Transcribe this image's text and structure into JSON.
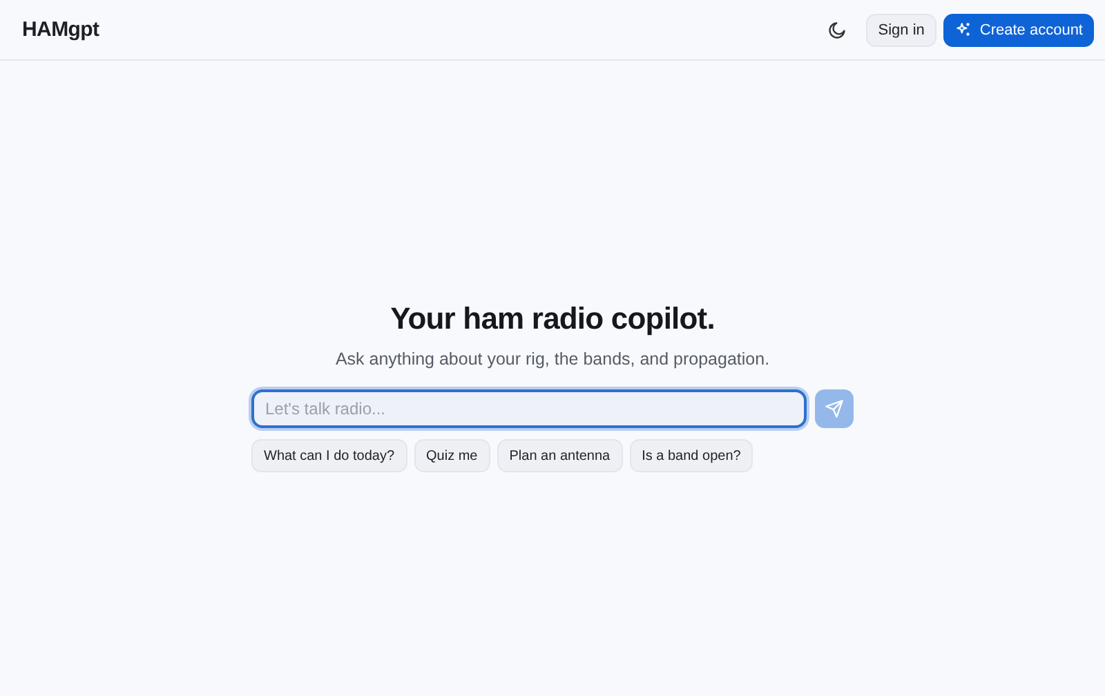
{
  "header": {
    "logo": "HAMgpt",
    "buttons": [
      {
        "kind": "secondary",
        "label": "Sign in"
      },
      {
        "kind": "primary",
        "label": "Create account"
      }
    ]
  },
  "hero": {
    "title": "Your ham radio copilot.",
    "subtitle": "Ask anything about your rig, the bands, and propagation."
  },
  "composer": {
    "placeholder": "Let's talk radio...",
    "send_disabled": true
  },
  "suggestions": [
    "What can I do today?",
    "Quiz me",
    "Plan an antenna",
    "Is a band open?"
  ]
}
